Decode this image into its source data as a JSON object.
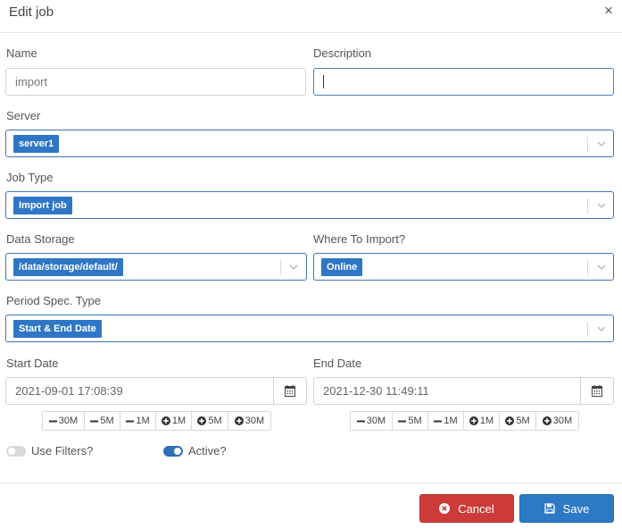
{
  "dialog": {
    "title": "Edit job",
    "close_glyph": "×"
  },
  "fields": {
    "name": {
      "label": "Name",
      "value": "import"
    },
    "description": {
      "label": "Description",
      "value": ""
    },
    "server": {
      "label": "Server",
      "selected": "server1"
    },
    "job_type": {
      "label": "Job Type",
      "selected": "Import job"
    },
    "data_storage": {
      "label": "Data Storage",
      "selected": "/data/storage/default/"
    },
    "where_to_import": {
      "label": "Where To Import?",
      "selected": "Online"
    },
    "period_spec_type": {
      "label": "Period Spec. Type",
      "selected": "Start & End Date"
    },
    "start_date": {
      "label": "Start Date",
      "value": "2021-09-01 17:08:39"
    },
    "end_date": {
      "label": "End Date",
      "value": "2021-12-30 11:49:11"
    }
  },
  "adjust_buttons": [
    "30M",
    "5M",
    "1M",
    "1M",
    "5M",
    "30M"
  ],
  "toggles": {
    "use_filters": {
      "label": "Use Filters?",
      "on": false
    },
    "active": {
      "label": "Active?",
      "on": true
    }
  },
  "footer": {
    "cancel_label": "Cancel",
    "save_label": "Save"
  },
  "icons": {
    "select_arrow": "chevron-down-icon",
    "calendar": "calendar-icon",
    "minus": "minus-icon",
    "plus": "plus-circle-icon",
    "cancel": "times-circle-icon",
    "save": "floppy-disk-icon"
  },
  "colors": {
    "tag": "#2f77c6",
    "select_border": "#3f73b6",
    "cancel": "#cc3b37",
    "save": "#2c79c6",
    "toggle_on": "#2f6fb7",
    "toggle_off": "#d9d9d9"
  }
}
